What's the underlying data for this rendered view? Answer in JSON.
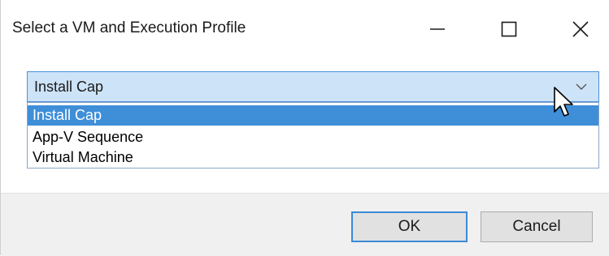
{
  "window": {
    "title": "Select a VM and Execution Profile",
    "controls": {
      "minimize_icon": "minimize-icon",
      "maximize_icon": "maximize-icon",
      "close_icon": "close-icon"
    }
  },
  "combo": {
    "selected_value": "Install Cap",
    "arrow_icon": "chevron-down-icon",
    "options": [
      "Install Cap",
      "App-V Sequence",
      "Virtual Machine"
    ],
    "highlighted_index": 0
  },
  "footer": {
    "ok_label": "OK",
    "cancel_label": "Cancel"
  },
  "colors": {
    "combo_background": "#cde3f7",
    "combo_border": "#4a90d9",
    "selection_highlight": "#3f8ed8",
    "footer_background": "#f0f0f0",
    "default_button_border": "#3c8ad6"
  }
}
